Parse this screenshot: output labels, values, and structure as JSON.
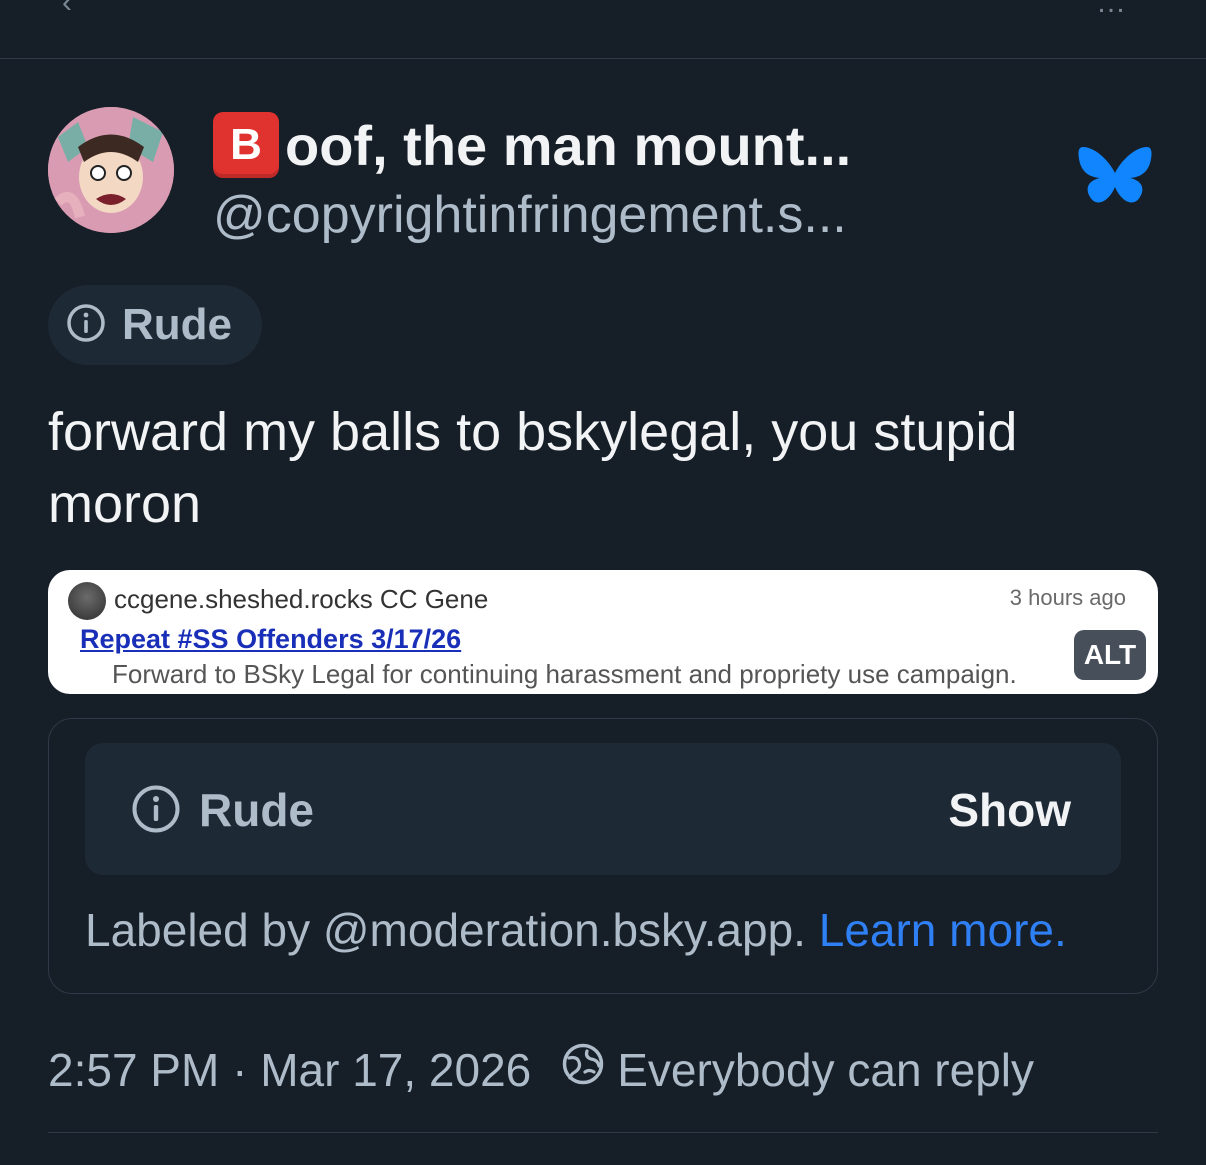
{
  "header": {
    "back_glyph": "‹",
    "right_glyph": "…"
  },
  "author": {
    "display_name_emoji_letter": "B",
    "display_name": "oof, the man mount...",
    "handle": "@copyrightinfringement.s..."
  },
  "content_label": {
    "label": "Rude"
  },
  "post": {
    "text": "forward my balls to bskylegal, you stupid moron"
  },
  "embed": {
    "author": "ccgene.sheshed.rocks CC Gene",
    "time": "3 hours ago",
    "link_title": "Repeat #SS Offenders 3/17/26",
    "description": "Forward to BSky Legal for continuing harassment and propriety use campaign.",
    "alt_badge": "ALT"
  },
  "moderation": {
    "label": "Rude",
    "show_button": "Show",
    "labeled_by_prefix": "Labeled by @moderation.bsky.app.",
    "learn_more": "Learn more."
  },
  "meta": {
    "timestamp": "2:57 PM · Mar 17, 2026",
    "reply_setting": "Everybody can reply"
  },
  "colors": {
    "background": "#161e27",
    "accent_blue": "#2f7ff5",
    "butterfly": "#1185fe",
    "emoji_red": "#e0322f"
  },
  "icons": [
    "back-icon",
    "more-icon",
    "bluesky-butterfly-icon",
    "info-icon",
    "globe-icon"
  ]
}
